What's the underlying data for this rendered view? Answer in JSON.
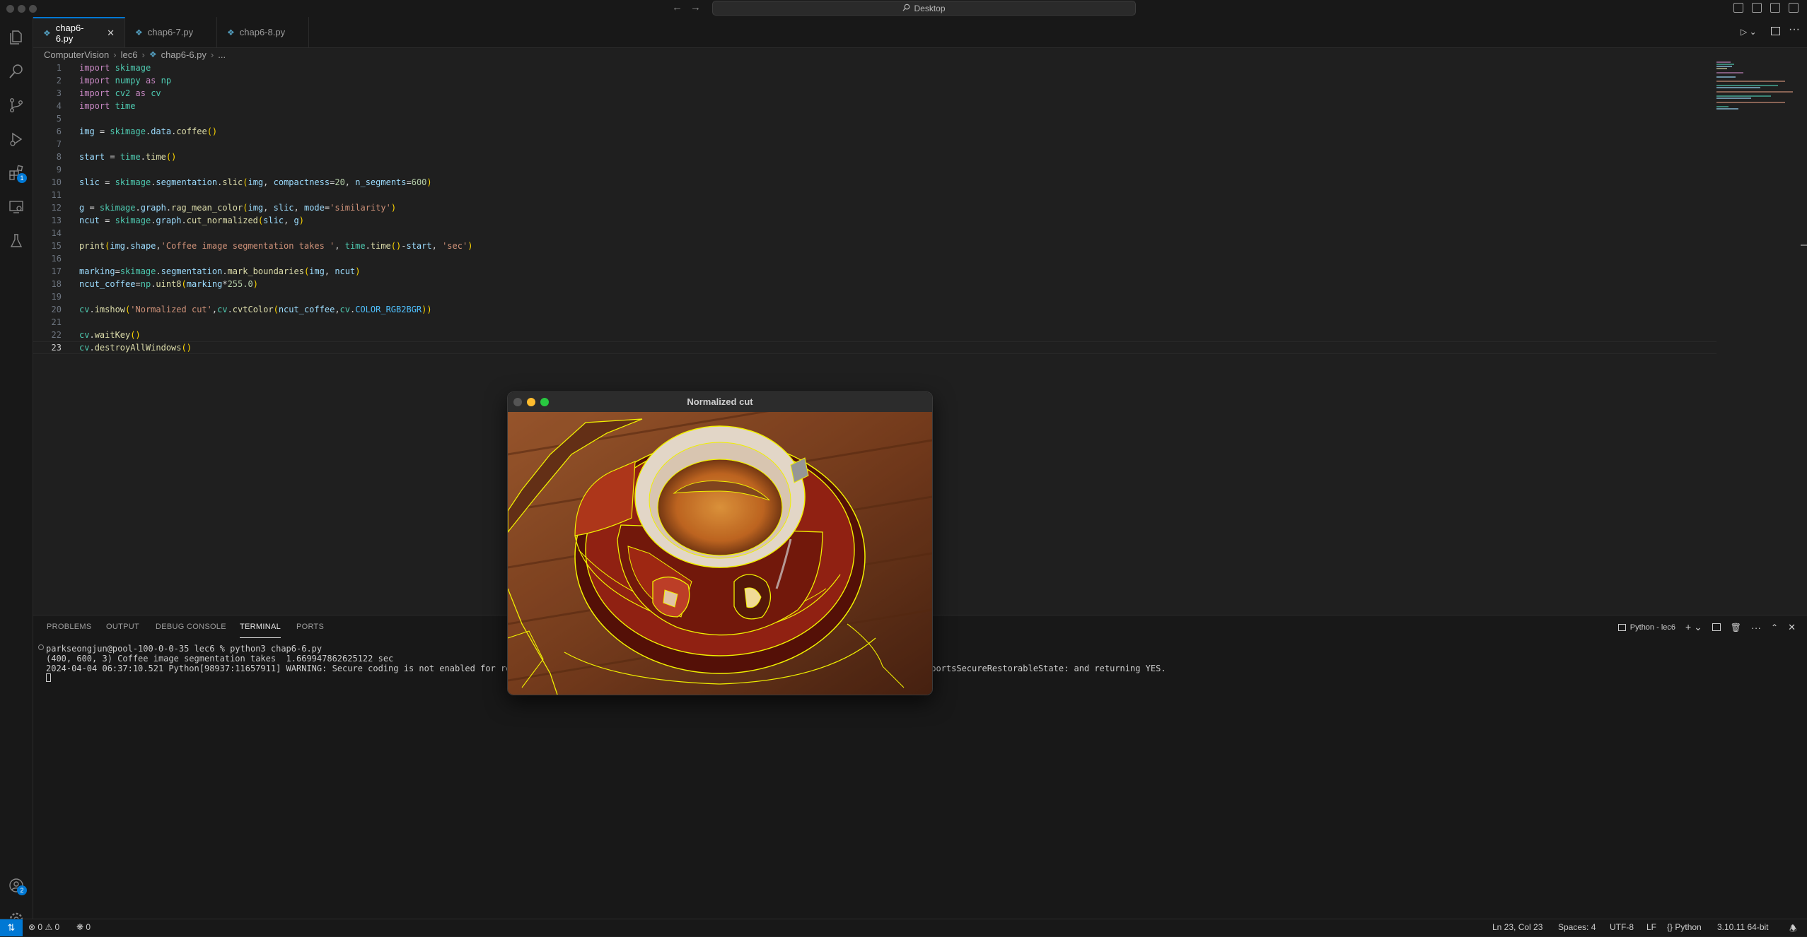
{
  "titlebar": {
    "search_text": "Desktop"
  },
  "tabs": [
    {
      "label": "chap6-6.py",
      "active": true
    },
    {
      "label": "chap6-7.py",
      "active": false
    },
    {
      "label": "chap6-8.py",
      "active": false
    }
  ],
  "breadcrumbs": [
    "ComputerVision",
    "lec6",
    "chap6-6.py",
    "..."
  ],
  "editor": {
    "line_numbers": [
      "1",
      "2",
      "3",
      "4",
      "5",
      "6",
      "7",
      "8",
      "9",
      "10",
      "11",
      "12",
      "13",
      "14",
      "15",
      "16",
      "17",
      "18",
      "19",
      "20",
      "21",
      "22",
      "23"
    ],
    "current_line": "23",
    "code": [
      "import skimage",
      "import numpy as np",
      "import cv2 as cv",
      "import time",
      "",
      "img = skimage.data.coffee()",
      "",
      "start = time.time()",
      "",
      "slic = skimage.segmentation.slic(img, compactness=20, n_segments=600)",
      "",
      "g = skimage.graph.rag_mean_color(img, slic, mode='similarity')",
      "ncut = skimage.graph.cut_normalized(slic, g)",
      "",
      "print(img.shape,'Coffee image segmentation takes ', time.time()-start, 'sec')",
      "",
      "marking=skimage.segmentation.mark_boundaries(img, ncut)",
      "ncut_coffee=np.uint8(marking*255.0)",
      "",
      "cv.imshow('Normalized cut',cv.cvtColor(ncut_coffee,cv.COLOR_RGB2BGR))",
      "",
      "cv.waitKey()",
      "cv.destroyAllWindows()"
    ]
  },
  "activity_badges": {
    "extensions": "1",
    "accounts": "2"
  },
  "panel": {
    "tabs": [
      "PROBLEMS",
      "OUTPUT",
      "DEBUG CONSOLE",
      "TERMINAL",
      "PORTS"
    ],
    "active_tab": "TERMINAL",
    "terminal_name": "Python - lec6",
    "terminal_lines": [
      "parkseongjun@pool-100-0-0-35 lec6 % python3 chap6-6.py",
      "(400, 600, 3) Coffee image segmentation takes  1.669947862625122 sec",
      "2024-04-04 06:37:10.521 Python[98937:11657911] WARNING: Secure coding is not enabled for rest",
      "pportsSecureRestorableState: and returning YES."
    ]
  },
  "statusbar": {
    "errors": "0",
    "warnings": "0",
    "ports": "0",
    "position": "Ln 23, Col 23",
    "spaces": "Spaces: 4",
    "encoding": "UTF-8",
    "eol": "LF",
    "language": "Python",
    "interpreter": "3.10.11 64-bit"
  },
  "cv_window": {
    "title": "Normalized cut"
  },
  "colors": {
    "accent": "#0078d4",
    "boundary": "#ffff00",
    "coffee_table": "#8a4a26",
    "cup_red": "#9a2414"
  }
}
